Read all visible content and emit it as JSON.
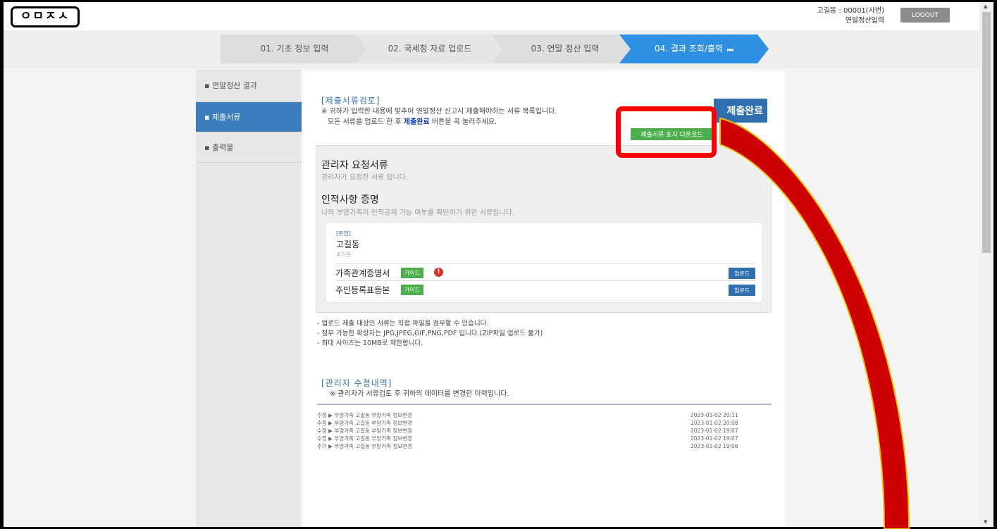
{
  "header": {
    "logo": "ㅇㅁㅈㅅ",
    "user_line1": "고길동 : 00001(사번)",
    "user_line2": "연말정산입력",
    "logout": "LOGOUT"
  },
  "steps": [
    {
      "label": "01. 기초 정보 입력"
    },
    {
      "label": "02. 국세청 자료 업로드"
    },
    {
      "label": "03. 연말 정산 입력"
    },
    {
      "label": "04. 결과 조회/출력",
      "arrows": "▸▸▸"
    }
  ],
  "sidebar": {
    "items": [
      {
        "label": "▪ 연말정산 결과"
      },
      {
        "label": "▪ 제출서류"
      },
      {
        "label": "▪ 출력물"
      }
    ]
  },
  "review": {
    "title": "[제출서류검토]",
    "note1": "※ 귀하가 입력한 내용에 맞추어 연말정산 신고시 제출해야하는 서류 목록입니다.",
    "note2_pre": "모든 서류를 업로드 한 후 ",
    "note2_bold": "제출완료",
    "note2_post": " 버튼을 꼭 눌러주세요.",
    "submit_button": "제출완료",
    "download_button": "제출서류 표지 다운로드"
  },
  "panel": {
    "admin_title": "관리자 요청서류",
    "admin_sub": "관리자가 요청한 서류 입니다.",
    "personal_title": "인적사항 증명",
    "personal_sub": "나의 부양가족의 인적공제 가능 여부를 확인하기 위한 서류입니다.",
    "card": {
      "tag": "[본인]",
      "name": "고길동",
      "basic": "#기본",
      "docs": [
        {
          "name": "가족관계증명서",
          "guide": "가이드",
          "warn": "!",
          "upload": "업로드"
        },
        {
          "name": "주민등록표등본",
          "guide": "가이드",
          "upload": "업로드"
        }
      ]
    }
  },
  "info": {
    "line1": "- 업로드 제출 대상인 서류는 직접 파일을 첨부할 수 있습니다.",
    "line2": "- 첨부 가능한 확장자는 JPG,JPEG,GIF,PNG,PDF 입니다.(ZIP파일 업로드 불가)",
    "line3": "- 최대 사이즈는 10MB로 제한합니다."
  },
  "history": {
    "title": "[관리자 수정내역]",
    "note": "※ 관리자가 서류검토 후 귀하의 데이터를 변경한 이력입니다.",
    "rows": [
      {
        "text": "수정 ▶ 부양가족 고길동 부양가족 정보변경",
        "date": "2023-01-02 20:11"
      },
      {
        "text": "수정 ▶ 부양가족 고길동 부양가족 정보변경",
        "date": "2023-01-02 20:08"
      },
      {
        "text": "수정 ▶ 부양가족 고길동 부양가족 정보변경",
        "date": "2023-01-02 19:07"
      },
      {
        "text": "수정 ▶ 부양가족 고길동 부양가족 정보변경",
        "date": "2023-01-02 19:07"
      },
      {
        "text": "추가 ▶ 부양가족 고길동 부양가족 정보변경",
        "date": "2023-01-02 19:06"
      }
    ]
  },
  "colors": {
    "accent": "#2f8fe0",
    "sidebar_active": "#3b7dbd",
    "green": "#4cae4c",
    "highlight": "#ff0000"
  }
}
